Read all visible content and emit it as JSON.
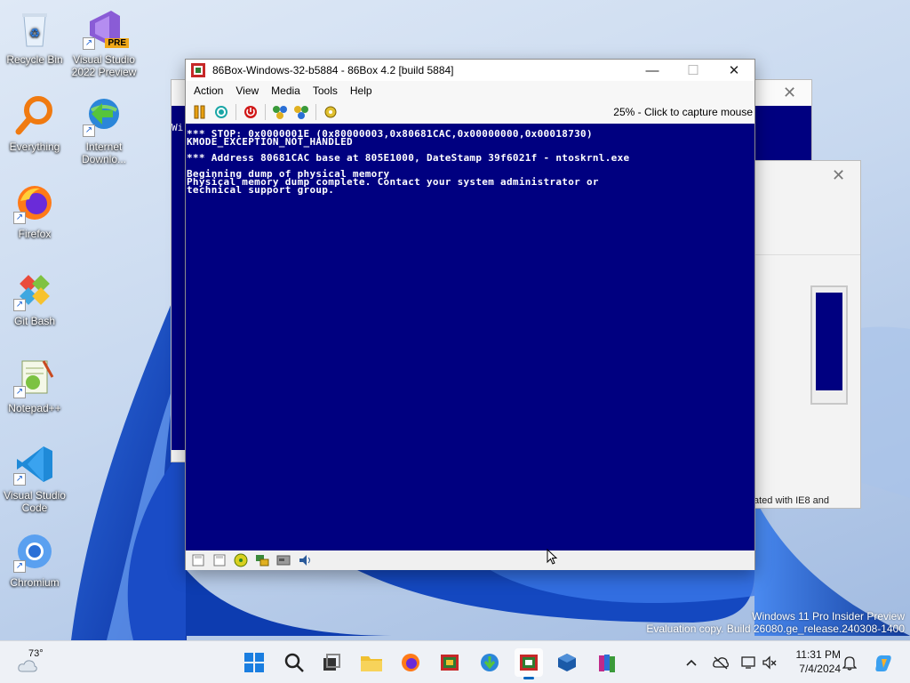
{
  "desktop": {
    "icons": [
      {
        "label": "Recycle Bin"
      },
      {
        "label": "Visual Studio 2022 Preview",
        "badge": "PRE"
      },
      {
        "label": "Everything"
      },
      {
        "label": "Internet Downlo..."
      },
      {
        "label": "Firefox"
      },
      {
        "label": "Git Bash"
      },
      {
        "label": "Notepad++"
      },
      {
        "label": "Visual Studio Code"
      },
      {
        "label": "Chromium"
      }
    ]
  },
  "background_windows": {
    "back_title_fragment": "Wi",
    "front_text_fragment": "ated with IE8 and"
  },
  "window": {
    "title": "86Box-Windows-32-b5884 - 86Box 4.2 [build 5884]",
    "controls": {
      "minimize": "—",
      "maximize": "☐",
      "close": "✕"
    },
    "menu": [
      "Action",
      "View",
      "Media",
      "Tools",
      "Help"
    ],
    "toolbar_icons": [
      "pause-icon",
      "hard-reset-icon",
      "power-icon",
      "ctrl-alt-del-icon",
      "ctrl-alt-esc-icon",
      "settings-icon"
    ],
    "capture_hint": "25% - Click to capture mouse",
    "screen": {
      "background": "#000080",
      "foreground": "#ffffff",
      "lines": [
        "*** STOP: 0x0000001E (0x80000003,0x80681CAC,0x00000000,0x00018730)",
        "KMODE_EXCEPTION_NOT_HANDLED",
        "",
        "*** Address 80681CAC base at 805E1000, DateStamp 39f6021f - ntoskrnl.exe",
        "",
        "Beginning dump of physical memory",
        "Physical memory dump complete. Contact your system administrator or",
        "technical support group."
      ]
    },
    "status_icons": [
      "floppy-a-icon",
      "floppy-b-icon",
      "cdrom-icon",
      "network-icon",
      "hdd-icon",
      "sound-icon"
    ]
  },
  "watermark": {
    "line1": "Windows 11 Pro Insider Preview",
    "line2": "Evaluation copy. Build 26080.ge_release.240308-1400"
  },
  "taskbar": {
    "weather_temp": "73°",
    "apps": [
      "start-icon",
      "search-icon",
      "task-view-icon",
      "file-explorer-icon",
      "firefox-icon",
      "vm-manager-icon",
      "internet-download-manager-icon",
      "86box-icon",
      "virtualbox-icon",
      "winrar-icon"
    ],
    "active_app": "86box-icon",
    "tray": [
      "chevron-up-icon",
      "cloud-offline-icon",
      "display-icon",
      "volume-muted-icon"
    ],
    "time": "11:31 PM",
    "date": "7/4/2024"
  }
}
